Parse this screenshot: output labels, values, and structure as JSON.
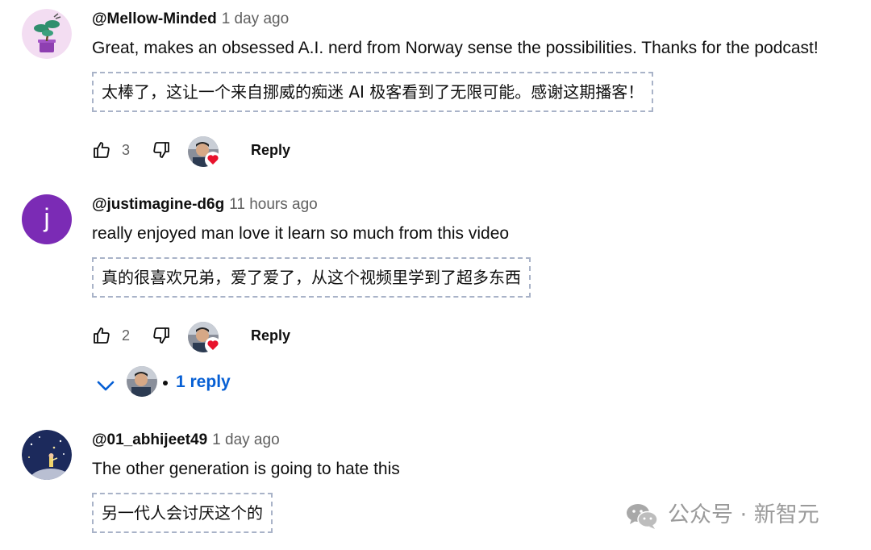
{
  "comments": [
    {
      "author": "@Mellow-Minded",
      "time": "1 day ago",
      "text": "Great, makes an obsessed A.I. nerd from Norway sense the possibilities. Thanks for the podcast!",
      "translation": "太棒了，这让一个来自挪威的痴迷 AI 极客看到了无限可能。感谢这期播客！",
      "likes": "3",
      "reply_label": "Reply",
      "avatar_icon": "bonsai-avatar"
    },
    {
      "author": "@justimagine-d6g",
      "time": "11 hours ago",
      "text": "really enjoyed man love it learn so much from this video",
      "translation": "真的很喜欢兄弟，爱了爱了，从这个视频里学到了超多东西",
      "likes": "2",
      "reply_label": "Reply",
      "avatar_letter": "j",
      "replies_label": "1 reply"
    },
    {
      "author": "@01_abhijeet49",
      "time": "1 day ago",
      "text": "The other generation is going to hate this",
      "translation": "另一代人会讨厌这个的",
      "avatar_icon": "little-prince-avatar"
    }
  ],
  "watermark": "公众号 · 新智元",
  "colors": {
    "link": "#065fd4",
    "heart": "#e8132d",
    "avatar_purple": "#7b2bb5",
    "dashed_border": "#a9b3c8"
  }
}
